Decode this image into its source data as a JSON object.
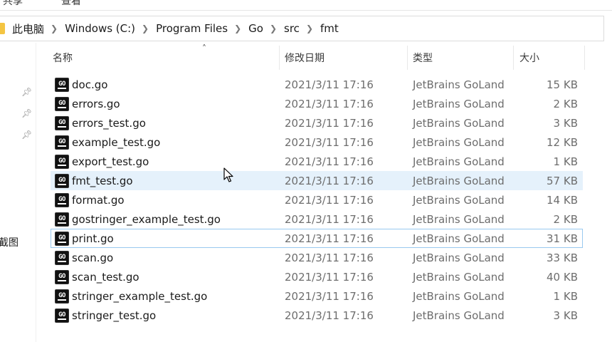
{
  "ribbon": {
    "tabs": [
      "共享",
      "查看"
    ]
  },
  "address": {
    "crumbs": [
      "此电脑",
      "Windows (C:)",
      "Program Files",
      "Go",
      "src",
      "fmt"
    ]
  },
  "nav": {
    "partial_label": "截图"
  },
  "columns": {
    "name": "名称",
    "date": "修改日期",
    "type": "类型",
    "size": "大小"
  },
  "files": [
    {
      "name": "doc.go",
      "date": "2021/3/11 17:16",
      "type": "JetBrains GoLand",
      "size": "15 KB"
    },
    {
      "name": "errors.go",
      "date": "2021/3/11 17:16",
      "type": "JetBrains GoLand",
      "size": "2 KB"
    },
    {
      "name": "errors_test.go",
      "date": "2021/3/11 17:16",
      "type": "JetBrains GoLand",
      "size": "3 KB"
    },
    {
      "name": "example_test.go",
      "date": "2021/3/11 17:16",
      "type": "JetBrains GoLand",
      "size": "12 KB"
    },
    {
      "name": "export_test.go",
      "date": "2021/3/11 17:16",
      "type": "JetBrains GoLand",
      "size": "1 KB"
    },
    {
      "name": "fmt_test.go",
      "date": "2021/3/11 17:16",
      "type": "JetBrains GoLand",
      "size": "57 KB"
    },
    {
      "name": "format.go",
      "date": "2021/3/11 17:16",
      "type": "JetBrains GoLand",
      "size": "14 KB"
    },
    {
      "name": "gostringer_example_test.go",
      "date": "2021/3/11 17:16",
      "type": "JetBrains GoLand",
      "size": "2 KB"
    },
    {
      "name": "print.go",
      "date": "2021/3/11 17:16",
      "type": "JetBrains GoLand",
      "size": "31 KB"
    },
    {
      "name": "scan.go",
      "date": "2021/3/11 17:16",
      "type": "JetBrains GoLand",
      "size": "33 KB"
    },
    {
      "name": "scan_test.go",
      "date": "2021/3/11 17:16",
      "type": "JetBrains GoLand",
      "size": "40 KB"
    },
    {
      "name": "stringer_example_test.go",
      "date": "2021/3/11 17:16",
      "type": "JetBrains GoLand",
      "size": "1 KB"
    },
    {
      "name": "stringer_test.go",
      "date": "2021/3/11 17:16",
      "type": "JetBrains GoLand",
      "size": "3 KB"
    }
  ],
  "file_icon": {
    "label": "GO",
    "name": "go-file-icon"
  },
  "hovered_index": 5,
  "focused_index": 8,
  "colors": {
    "hover": "#e5f1fb",
    "focus_border": "#99c9ef",
    "muted_text": "#6d6d6d"
  }
}
